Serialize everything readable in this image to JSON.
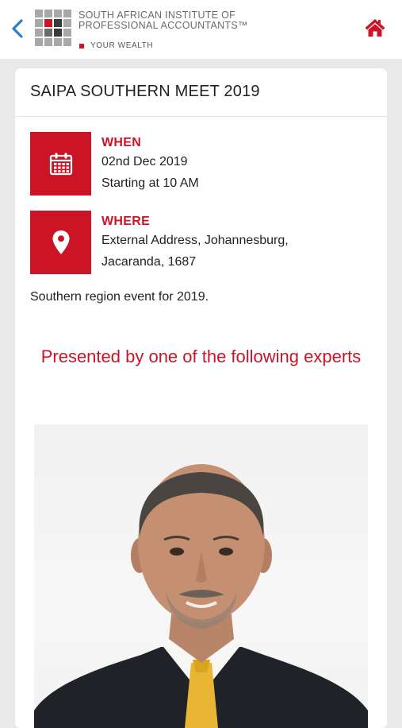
{
  "header": {
    "back_icon": "chevron-left-icon",
    "logo_line1": "SOUTH AFRICAN INSTITUTE OF",
    "logo_line2": "PROFESSIONAL ACCOUNTANTS™",
    "logo_tagline": "YOUR WEALTH",
    "home_icon": "home-icon",
    "accent_color": "#cc1427"
  },
  "event": {
    "title": "SAIPA SOUTHERN MEET 2019",
    "when": {
      "label": "WHEN",
      "date": "02nd Dec 2019",
      "time": "Starting at 10 AM",
      "icon": "calendar-icon"
    },
    "where": {
      "label": "WHERE",
      "address_line1": "External Address, Johannesburg,",
      "address_line2": "Jacaranda, 1687",
      "icon": "map-pin-icon"
    },
    "description": "Southern region event for 2019.",
    "presenters_heading": "Presented by one of the following experts"
  }
}
